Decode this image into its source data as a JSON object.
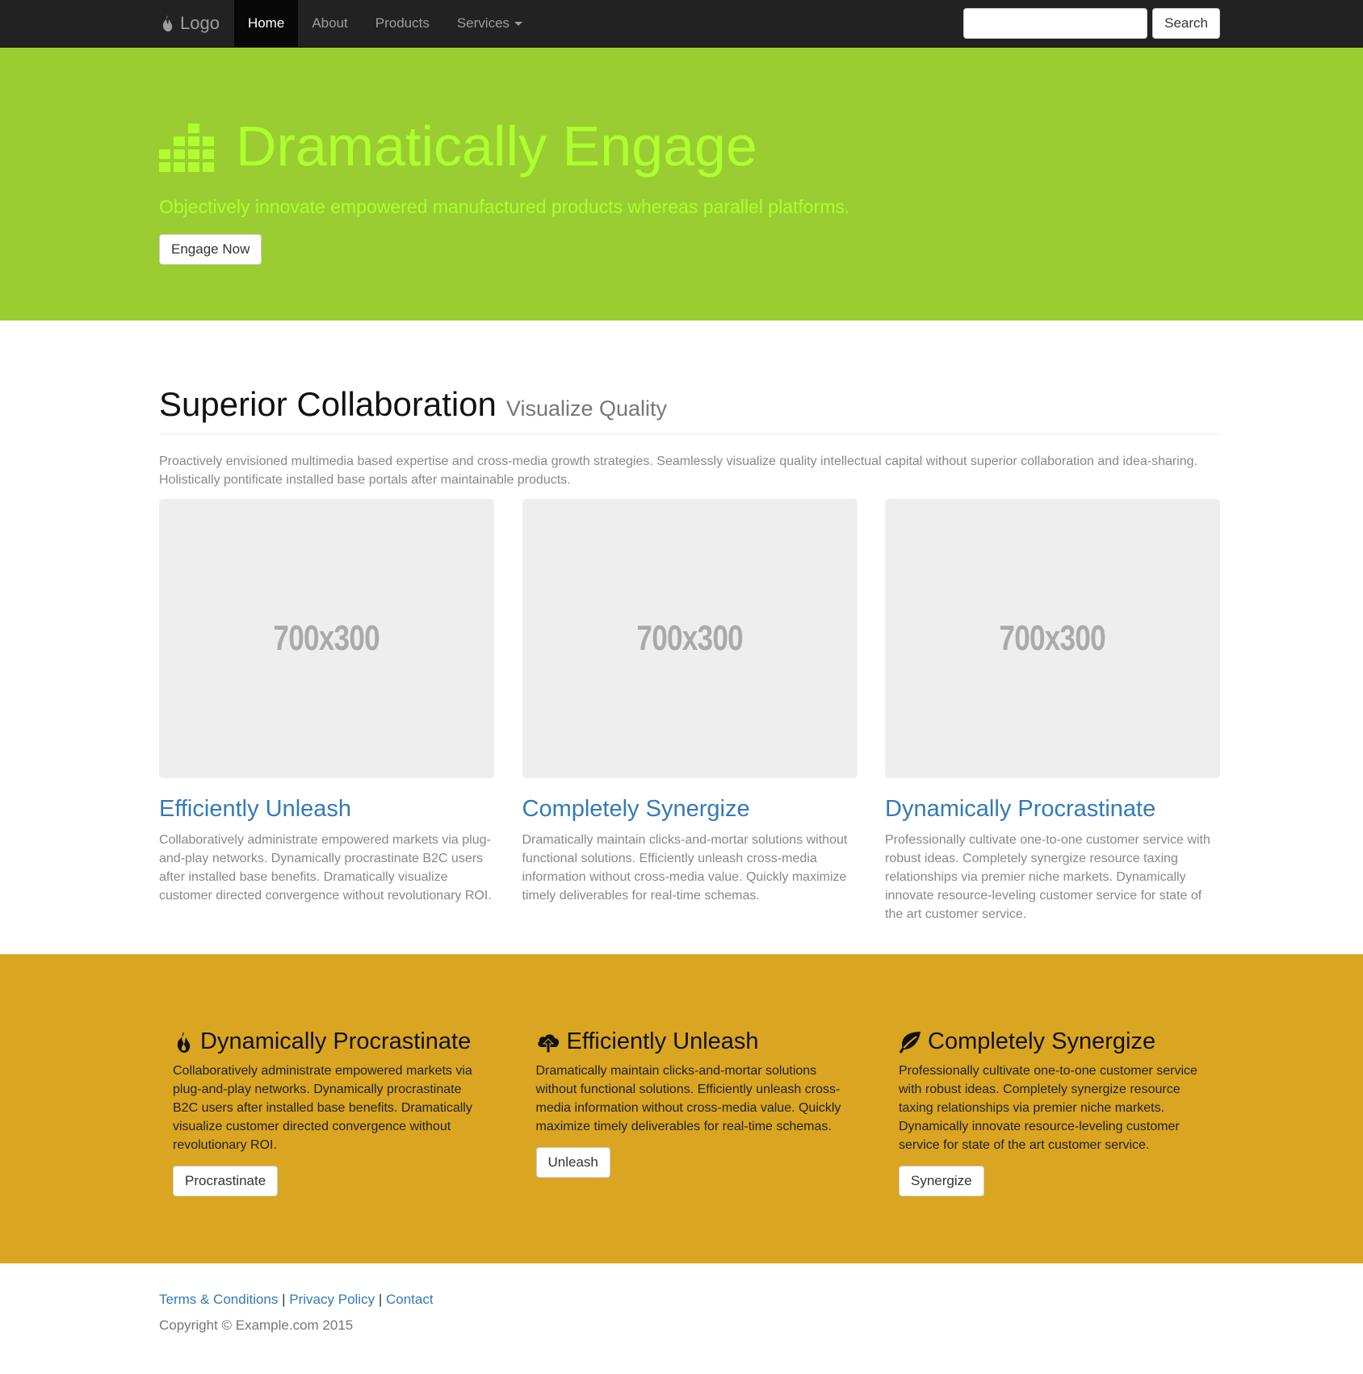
{
  "navbar": {
    "brand": "Logo",
    "items": [
      {
        "label": "Home"
      },
      {
        "label": "About"
      },
      {
        "label": "Products"
      },
      {
        "label": "Services"
      }
    ],
    "search_placeholder": "",
    "search_button": "Search"
  },
  "hero": {
    "title": "Dramatically Engage",
    "subtitle": "Objectively innovate empowered manufactured products whereas parallel platforms.",
    "button": "Engage Now",
    "background": "#9acd32",
    "text_color": "#adff2f"
  },
  "section": {
    "title": "Superior Collaboration",
    "subtitle": "Visualize Quality",
    "intro": "Proactively envisioned multimedia based expertise and cross-media growth strategies. Seamlessly visualize quality intellectual capital without superior collaboration and idea-sharing. Holistically pontificate installed base portals after maintainable products.",
    "cards": [
      {
        "image_text": "700x300",
        "title": "Efficiently Unleash",
        "text": "Collaboratively administrate empowered markets via plug-and-play networks. Dynamically procrastinate B2C users after installed base benefits. Dramatically visualize customer directed convergence without revolutionary ROI."
      },
      {
        "image_text": "700x300",
        "title": "Completely Synergize",
        "text": "Dramatically maintain clicks-and-mortar solutions without functional solutions. Efficiently unleash cross-media information without cross-media value. Quickly maximize timely deliverables for real-time schemas."
      },
      {
        "image_text": "700x300",
        "title": "Dynamically Procrastinate",
        "text": "Professionally cultivate one-to-one customer service with robust ideas. Completely synergize resource taxing relationships via premier niche markets. Dynamically innovate resource-leveling customer service for state of the art customer service."
      }
    ]
  },
  "features": {
    "background": "#daa520",
    "items": [
      {
        "icon": "fire-icon",
        "title": "Dynamically Procrastinate",
        "text": "Collaboratively administrate empowered markets via plug-and-play networks. Dynamically procrastinate B2C users after installed base benefits. Dramatically visualize customer directed convergence without revolutionary ROI.",
        "button": "Procrastinate"
      },
      {
        "icon": "cloud-upload-icon",
        "title": "Efficiently Unleash",
        "text": "Dramatically maintain clicks-and-mortar solutions without functional solutions. Efficiently unleash cross-media information without cross-media value. Quickly maximize timely deliverables for real-time schemas.",
        "button": "Unleash"
      },
      {
        "icon": "leaf-icon",
        "title": "Completely Synergize",
        "text": "Professionally cultivate one-to-one customer service with robust ideas. Completely synergize resource taxing relationships via premier niche markets. Dynamically innovate resource-leveling customer service for state of the art customer service.",
        "button": "Synergize"
      }
    ]
  },
  "footer": {
    "links": [
      {
        "label": "Terms & Conditions"
      },
      {
        "label": "Privacy Policy"
      },
      {
        "label": "Contact"
      }
    ],
    "separator": "|",
    "copyright": "Copyright © Example.com 2015"
  }
}
